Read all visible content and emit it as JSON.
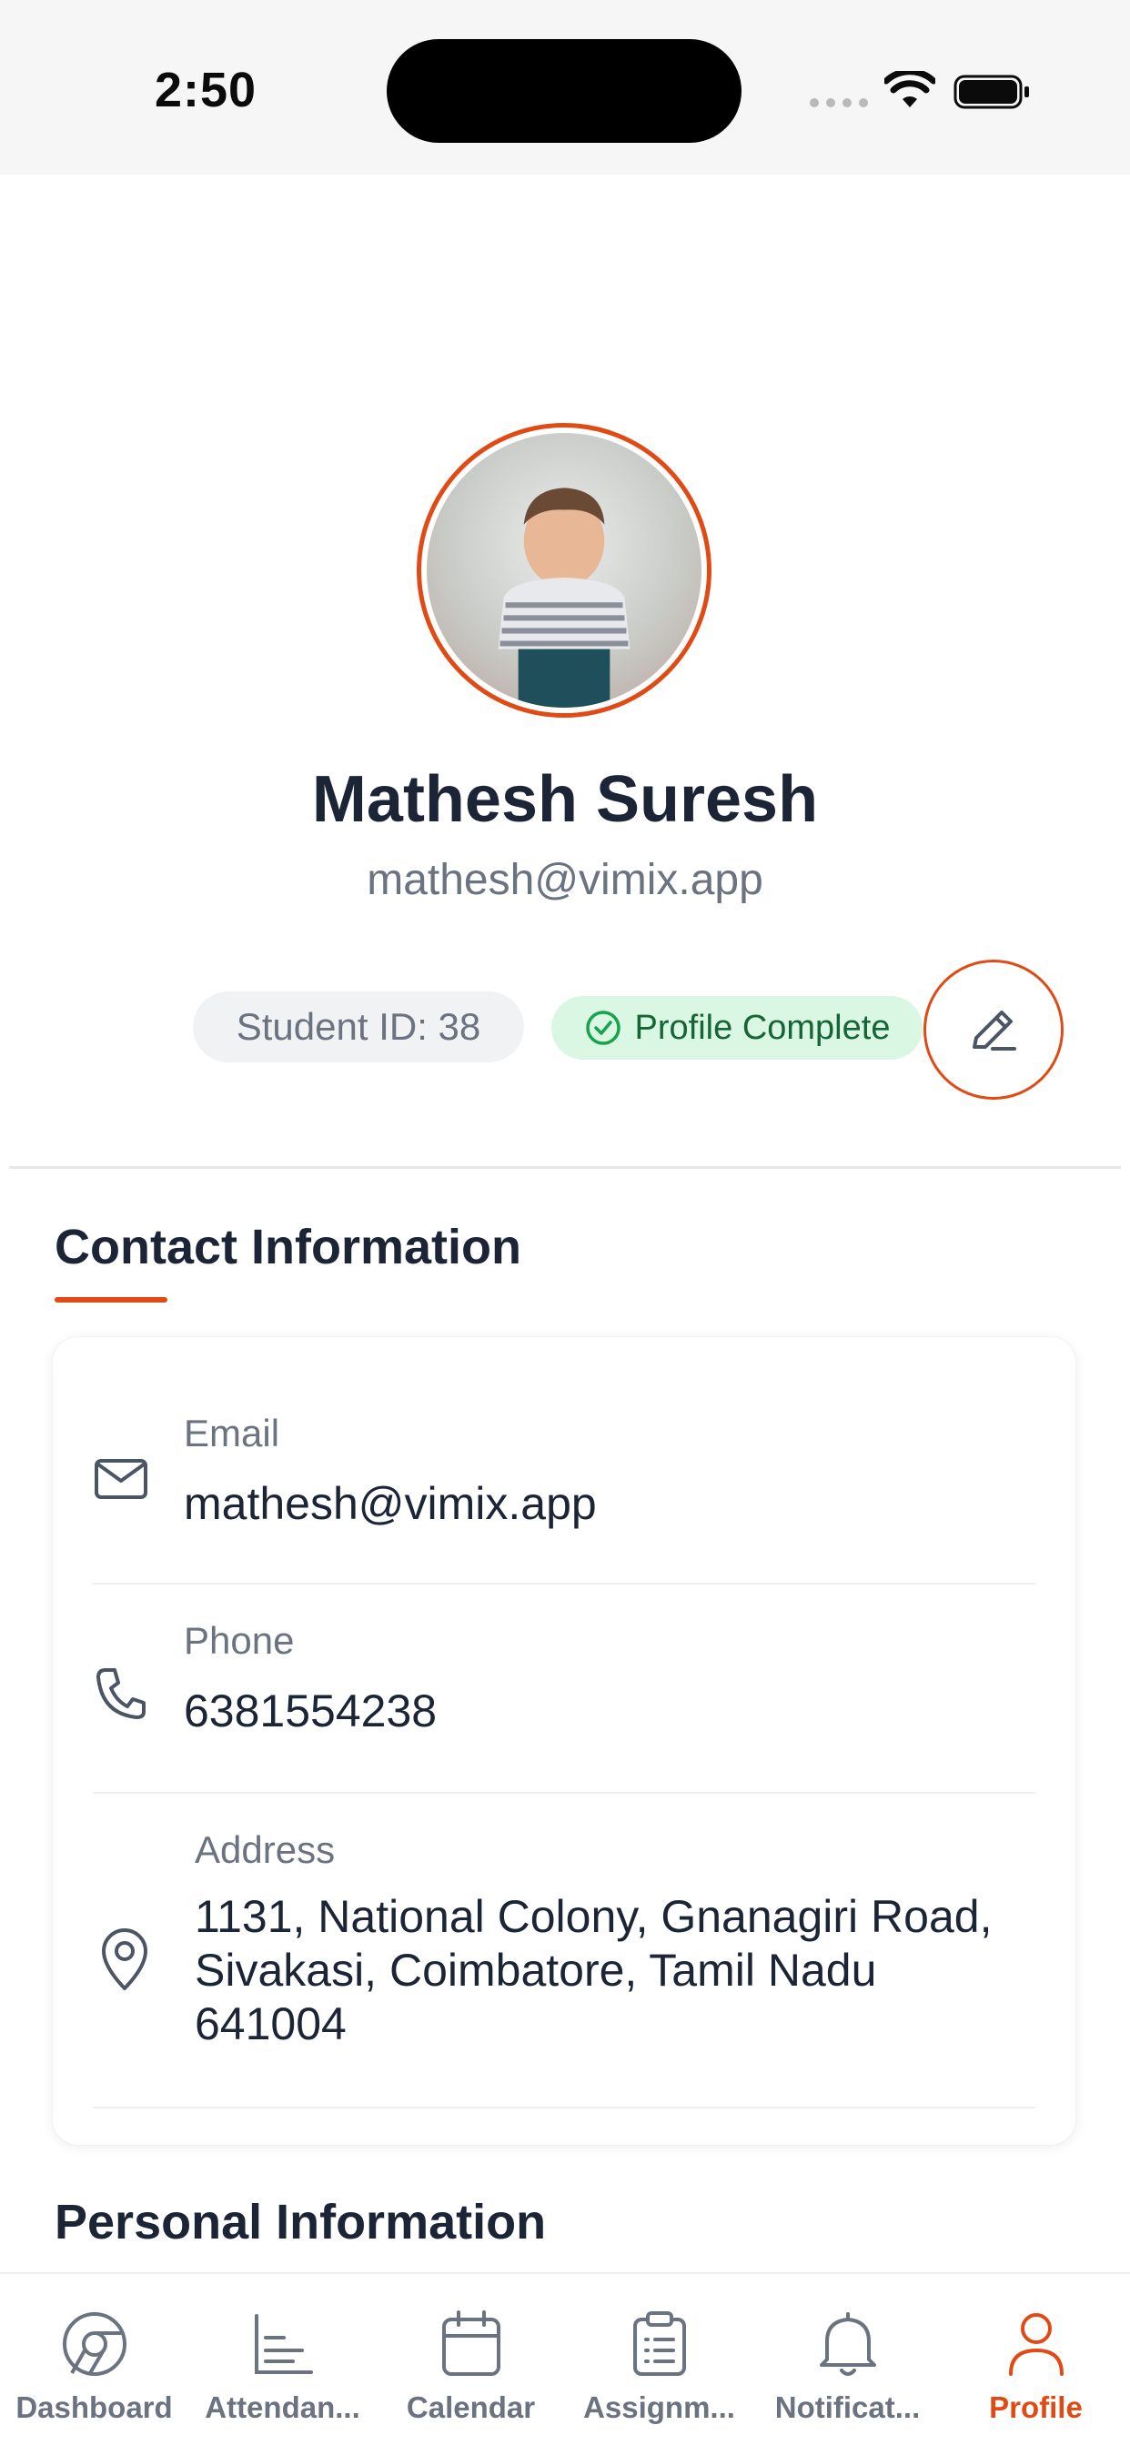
{
  "status_bar": {
    "time": "2:50"
  },
  "profile": {
    "name": "Mathesh Suresh",
    "email": "mathesh@vimix.app",
    "student_id": "Student ID: 38",
    "status_badge": "Profile Complete"
  },
  "contact_section": {
    "title": "Contact Information",
    "rows": [
      {
        "icon": "mail-icon",
        "label": "Email",
        "value": "mathesh@vimix.app"
      },
      {
        "icon": "phone-icon",
        "label": "Phone",
        "value": "6381554238"
      },
      {
        "icon": "location-pin-icon",
        "label": "Address",
        "lines": [
          "1131, National Colony, Gnanagiri Road,",
          "Sivakasi, Coimbatore, Tamil Nadu",
          "641004"
        ]
      }
    ]
  },
  "personal_section": {
    "title": "Personal Information"
  },
  "tab_bar": {
    "tabs": [
      {
        "label": "Dashboard",
        "icon": "chrome-icon"
      },
      {
        "label": "Attendan...",
        "icon": "chart-icon"
      },
      {
        "label": "Calendar",
        "icon": "calendar-icon"
      },
      {
        "label": "Assignm...",
        "icon": "clipboard-icon"
      },
      {
        "label": "Notificat...",
        "icon": "bell-icon"
      },
      {
        "label": "Profile",
        "icon": "user-icon"
      }
    ],
    "active_index": 5
  },
  "colors": {
    "accent": "#e04a14",
    "success_bg": "#d9f7e3",
    "success_text": "#166534"
  }
}
